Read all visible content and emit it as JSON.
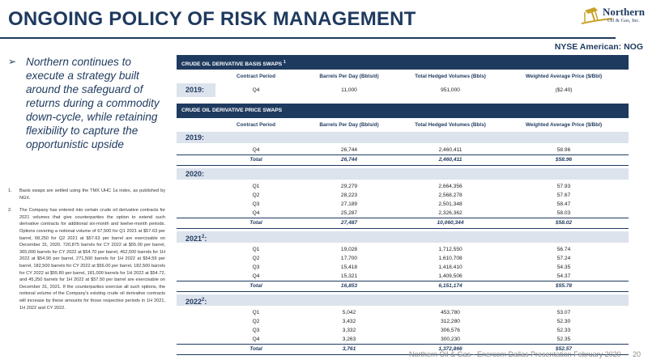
{
  "header": {
    "title": "ONGOING POLICY OF RISK MANAGEMENT",
    "logo_name": "Northern",
    "logo_sub": "Oil & Gas, Inc.",
    "exchange": "NYSE American: NOG"
  },
  "left": {
    "bullet_arrow": "➢",
    "bullet": "Northern continues to execute a strategy built around the safeguard of returns during a commodity down-cycle, while retaining flexibility to capture the opportunistic upside",
    "notes": [
      {
        "num": "1.",
        "text": "Basis swaps are settled using the TMX UHC 1a index, as published by NGX."
      },
      {
        "num": "2.",
        "text": "The Company has entered into certain crude oil derivative contracts for 2021 volumes that give counterparties the option to extend such derivative contracts for additional six-month and twelve-month periods. Options covering a notional volume of 67,500 for Q1 2021 at $57.63 per barrel, 68,250 for Q2 2021 at $57.63 per barrel are exercisable on December 31, 2020. 720,875 barrels for CY 2022 at $55.00 per barrel, 365,000 barrels for CY 2022 at $54.70 per barrel, 452,500 barrels for 1H 2022 at $54.90 per barrel, 271,500 barrels for 1H 2022 at $54.59 per barrel, 182,500 barrels for CY 2022 at $56.00 per barrel, 182,500 barrels for CY 2022 at $55.80 per barrel, 181,000 barrels for 1H 2022 at $54.72, and 45,250 barrels for 1H 2022 at $57.50 per barrel are exercisable on December 31, 2021. If the counterparties exercise all such options, the notional volume of the Company's existing crude oil derivative contracts will increase by these amounts for those respective periods in 1H 2021, 1H 2022 and CY 2022."
      }
    ]
  },
  "basis": {
    "title": "CRUDE OIL DERIVATIVE BASIS SWAPS",
    "title_sup": "1",
    "columns": [
      "Contract Period",
      "Barrels Per Day (Bbls/d)",
      "Total Hedged Volumes (Bbls)",
      "Weighted Average Price ($/Bbl)"
    ],
    "year": "2019:",
    "row": [
      "Q4",
      "11,000",
      "951,000",
      "($2.40)"
    ]
  },
  "price": {
    "title": "CRUDE OIL DERIVATIVE PRICE SWAPS",
    "columns": [
      "Contract Period",
      "Barrels Per Day (Bbls/d)",
      "Total Hedged Volumes (Bbls)",
      "Weighted Average Price ($/Bbl)"
    ],
    "years": [
      {
        "label": "2019:",
        "sup": "",
        "rows": [
          [
            "Q4",
            "26,744",
            "2,460,411",
            "58.96"
          ]
        ],
        "total": [
          "Total",
          "26,744",
          "2,460,411",
          "$58.96"
        ]
      },
      {
        "label": "2020:",
        "sup": "",
        "rows": [
          [
            "Q1",
            "29,279",
            "2,664,356",
            "57.93"
          ],
          [
            "Q2",
            "28,223",
            "2,568,278",
            "57.67"
          ],
          [
            "Q3",
            "27,189",
            "2,501,348",
            "58.47"
          ],
          [
            "Q4",
            "25,287",
            "2,326,362",
            "58.03"
          ]
        ],
        "total": [
          "Total",
          "27,487",
          "10,060,344",
          "$58.02"
        ]
      },
      {
        "label": "2021",
        "sup": "2",
        "colon": ":",
        "rows": [
          [
            "Q1",
            "19,028",
            "1,712,550",
            "56.74"
          ],
          [
            "Q2",
            "17,700",
            "1,610,708",
            "57.24"
          ],
          [
            "Q3",
            "15,418",
            "1,418,410",
            "54.35"
          ],
          [
            "Q4",
            "15,321",
            "1,409,506",
            "54.37"
          ]
        ],
        "total": [
          "Total",
          "16,853",
          "6,151,174",
          "$55.78"
        ]
      },
      {
        "label": "2022",
        "sup": "2",
        "colon": ":",
        "rows": [
          [
            "Q1",
            "5,042",
            "453,780",
            "53.07"
          ],
          [
            "Q2",
            "3,432",
            "312,280",
            "52.30"
          ],
          [
            "Q3",
            "3,332",
            "306,576",
            "52.33"
          ],
          [
            "Q4",
            "3,263",
            "300,230",
            "52.35"
          ]
        ],
        "total": [
          "Total",
          "3,761",
          "1,372,866",
          "$52.57"
        ]
      }
    ]
  },
  "footer": {
    "text": "Northern Oil & Gas - Enercom Dallas Presentation February 2020",
    "page": "20"
  },
  "colors": {
    "navy": "#1f3a5f",
    "band": "#dde3ec",
    "gold": "#c9a227"
  },
  "icons": {
    "logo": "pumpjack-icon",
    "bullet": "arrow-bullet-icon"
  }
}
